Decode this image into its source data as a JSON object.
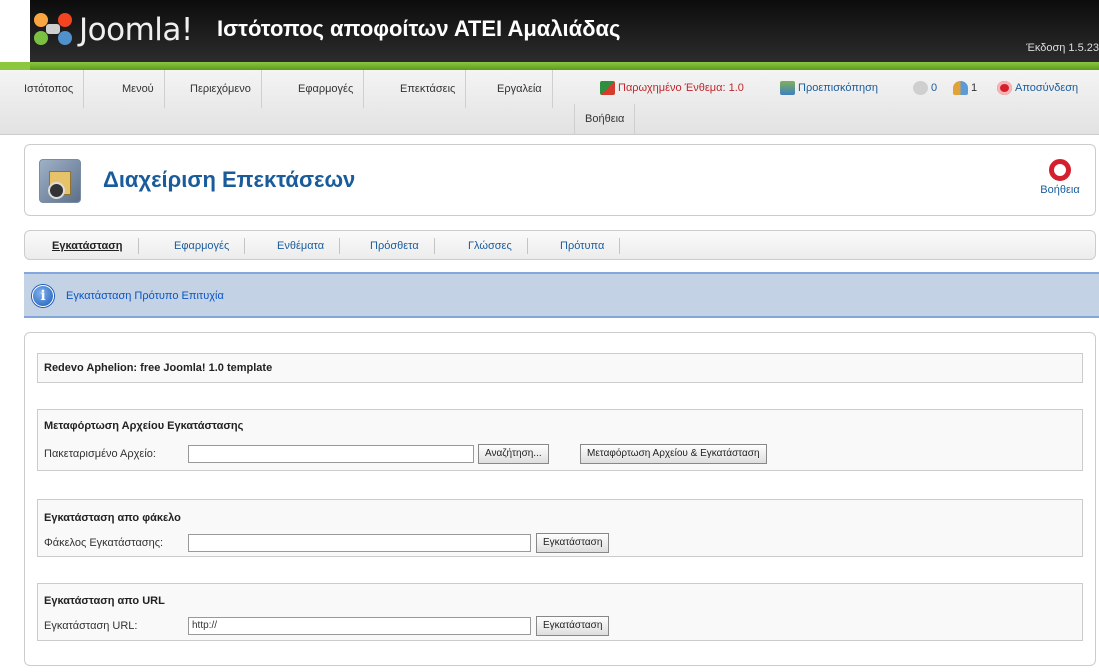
{
  "header": {
    "logo_text": "Joomla!",
    "site_title": "Ιστότοπος αποφοίτων ΑΤΕΙ Αμαλιάδας",
    "version": "Έκδοση 1.5.23"
  },
  "menu": {
    "items": [
      "Ιστότοπος",
      "Μενού",
      "Περιεχόμενο",
      "Εφαρμογές",
      "Επεκτάσεις",
      "Εργαλεία"
    ],
    "help": "Βοήθεια"
  },
  "status": {
    "legacy_plugin": "Παρωχημένο Ένθεμα: 1.0",
    "preview": "Προεπισκόπηση",
    "messages_count": "0",
    "users_count": "1",
    "logout": "Αποσύνδεση"
  },
  "toolbar": {
    "title": "Διαχείριση Επεκτάσεων",
    "help_label": "Βοήθεια"
  },
  "submenu": {
    "items": [
      "Εγκατάσταση",
      "Εφαρμογές",
      "Ενθέματα",
      "Πρόσθετα",
      "Γλώσσες",
      "Πρότυπα"
    ]
  },
  "message": {
    "text": "Εγκατάσταση Πρότυπο Επιτυχία"
  },
  "result": {
    "description": "Redevo Aphelion: free Joomla! 1.0 template"
  },
  "upload": {
    "title": "Μεταφόρτωση Αρχείου Εγκατάστασης",
    "label": "Πακεταρισμένο Αρχείο:",
    "browse": "Αναζήτηση...",
    "submit": "Μεταφόρτωση Αρχείου & Εγκατάσταση"
  },
  "folder": {
    "title": "Εγκατάσταση απο φάκελο",
    "label": "Φάκελος Εγκατάστασης:",
    "value": "",
    "submit": "Εγκατάσταση"
  },
  "url": {
    "title": "Εγκατάσταση απο URL",
    "label": "Εγκατάσταση URL:",
    "value": "http://",
    "submit": "Εγκατάσταση"
  },
  "colors": {
    "accent_blue": "#1a5c9b",
    "green_strip": "#8dc63f",
    "message_bg": "#c3d2e5",
    "status_red": "#d4202d"
  },
  "icons": {
    "logo": "joomla-logo-icon",
    "legacy": "legacy-plugin-icon",
    "preview": "preview-icon",
    "messages": "messages-icon",
    "users": "users-icon",
    "logout": "logout-icon",
    "page": "extension-manager-icon",
    "help": "help-lifebuoy-icon",
    "info": "info-icon"
  }
}
